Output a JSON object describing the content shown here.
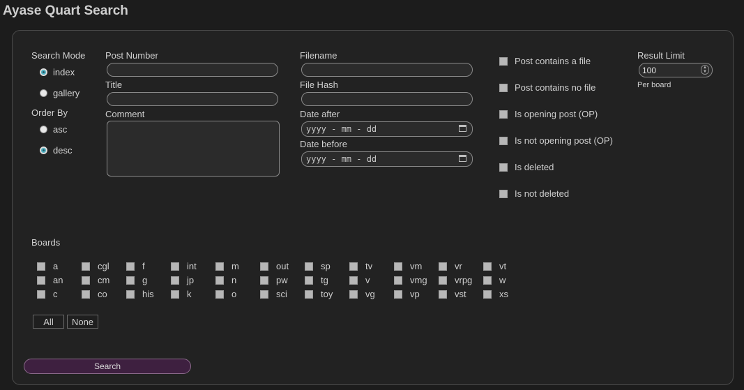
{
  "app": {
    "title": "Ayase Quart Search"
  },
  "search_mode": {
    "label": "Search Mode",
    "options": [
      "index",
      "gallery"
    ],
    "selected": "index"
  },
  "order_by": {
    "label": "Order By",
    "options": [
      "asc",
      "desc"
    ],
    "selected": "desc"
  },
  "fields": {
    "post_number": "Post Number",
    "title": "Title",
    "comment": "Comment",
    "filename": "Filename",
    "file_hash": "File Hash",
    "date_after": "Date after",
    "date_before": "Date before",
    "date_placeholder": "yyyy - mm - dd"
  },
  "filters": [
    "Post contains a file",
    "Post contains no file",
    "Is opening post (OP)",
    "Is not opening post (OP)",
    "Is deleted",
    "Is not deleted"
  ],
  "result_limit": {
    "label": "Result Limit",
    "value": "100",
    "note": "Per board"
  },
  "boards": {
    "label": "Boards",
    "columns": [
      [
        "a",
        "an",
        "c"
      ],
      [
        "cgl",
        "cm",
        "co"
      ],
      [
        "f",
        "g",
        "his"
      ],
      [
        "int",
        "jp",
        "k"
      ],
      [
        "m",
        "n",
        "o"
      ],
      [
        "out",
        "pw",
        "sci"
      ],
      [
        "sp",
        "tg",
        "toy"
      ],
      [
        "tv",
        "v",
        "vg"
      ],
      [
        "vm",
        "vmg",
        "vp"
      ],
      [
        "vr",
        "vrpg",
        "vst"
      ],
      [
        "vt",
        "w",
        "xs"
      ]
    ],
    "all_label": "All",
    "none_label": "None"
  },
  "search_button": "Search"
}
